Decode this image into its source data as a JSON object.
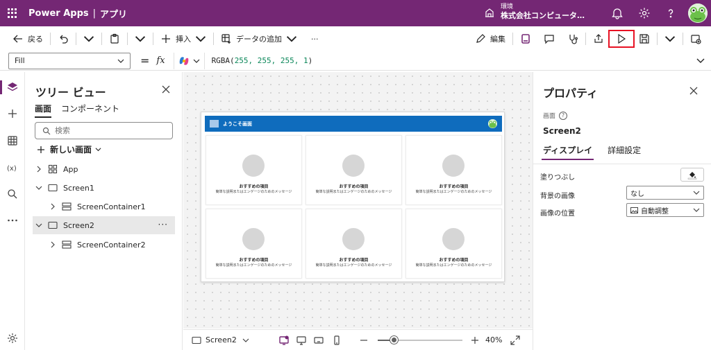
{
  "header": {
    "product": "Power Apps",
    "separator": "|",
    "app_title": "アプリ",
    "environment_label": "環境",
    "environment_value": "株式会社コンピュータ…"
  },
  "commandbar": {
    "back": "戻る",
    "insert": "挿入",
    "add_data": "データの追加",
    "more": "···",
    "edit": "編集"
  },
  "formulabar": {
    "property": "Fill",
    "equals": "=",
    "fx": "fx",
    "formula_func": "RGBA(",
    "formula_args": "255, 255, 255, 1",
    "formula_close": ")"
  },
  "tree": {
    "title": "ツリー ビュー",
    "tabs": [
      "画面",
      "コンポーネント"
    ],
    "search_placeholder": "検索",
    "new_screen": "新しい画面",
    "nodes": [
      "App",
      "Screen1",
      "ScreenContainer1",
      "Screen2",
      "ScreenContainer2"
    ],
    "node_more": "···"
  },
  "canvas": {
    "screen_header": "ようこそ画面",
    "card_title": "おすすめの項目",
    "card_subtitle": "簡単な説明またはエンゲージのためのメッセージ"
  },
  "bottombar": {
    "screen": "Screen2",
    "zoom": "40%",
    "zoom_level": 0.4
  },
  "properties": {
    "title": "プロパティ",
    "kind": "画面",
    "help": "?",
    "screen_name": "Screen2",
    "tabs": [
      "ディスプレイ",
      "詳細設定"
    ],
    "fill_label": "塗りつぶし",
    "bg_image_label": "背景の画像",
    "bg_image_value": "なし",
    "image_pos_label": "画像の位置",
    "image_pos_value": "自動調整"
  },
  "colors": {
    "brand": "#742774",
    "screen_header": "#0f6cbd",
    "highlight": "#e81123"
  }
}
